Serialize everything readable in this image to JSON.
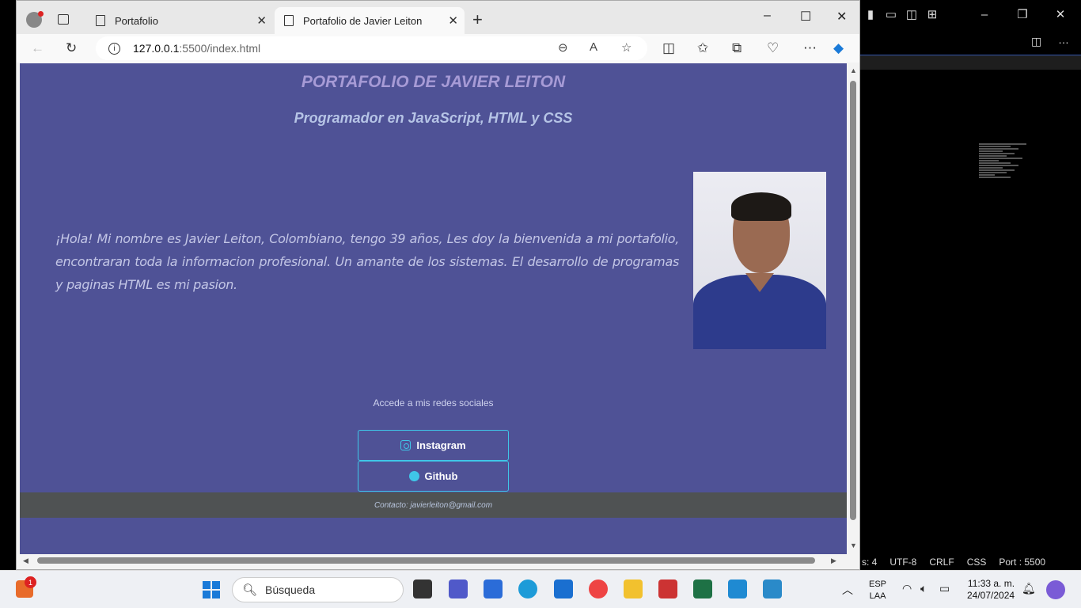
{
  "browser": {
    "tabs": [
      {
        "label": "Portafolio"
      },
      {
        "label": "Portafolio de Javier Leiton"
      }
    ],
    "url_host": "127.0.0.1",
    "url_path": ":5500/index.html"
  },
  "page": {
    "title": "PORTAFOLIO DE JAVIER LEITON",
    "subtitle": "Programador en JavaScript, HTML y CSS",
    "intro": "¡Hola! Mi nombre es Javier Leiton, Colombiano, tengo 39 años, Les doy la bienvenida a mi portafolio, encontraran toda la informacion profesional. Un amante de los sistemas. El desarrollo de programas y paginas HTML es mi pasion.",
    "social_label": "Accede a mis redes sociales",
    "instagram_label": "Instagram",
    "github_label": "Github",
    "footer": "Contacto: javierleiton@gmail.com"
  },
  "vscode": {
    "status": [
      "s: 4",
      "UTF-8",
      "CRLF",
      "CSS",
      "Port : 5500"
    ]
  },
  "taskbar": {
    "search_placeholder": "Búsqueda",
    "widget_badge": "1",
    "lang_line1": "ESP",
    "lang_line2": "LAA",
    "time": "11:33 a. m.",
    "date": "24/07/2024"
  },
  "colors": {
    "page_bg": "#4f5296",
    "accent": "#3fc6e8"
  }
}
